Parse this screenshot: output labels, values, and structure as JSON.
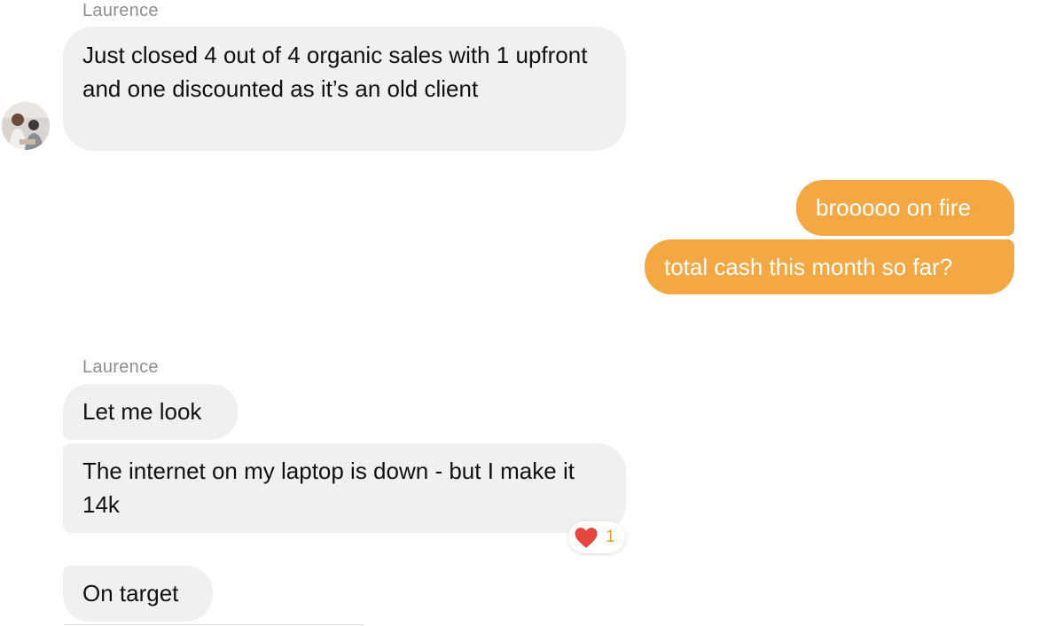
{
  "colors": {
    "incoming_bubble": "#f0f0f0",
    "outgoing_bubble": "#f3a843",
    "reaction_count": "#e99b34",
    "heart": "#e5473f"
  },
  "messages": [
    {
      "sender": "Laurence",
      "text": "Just closed 4 out of 4 organic sales with 1 upfront and one discounted as it’s an old client"
    },
    {
      "direction": "outgoing",
      "text": "brooooo on fire"
    },
    {
      "direction": "outgoing",
      "text": "total cash this month so far?"
    },
    {
      "sender": "Laurence",
      "text": "Let me look"
    },
    {
      "text": "The internet on my laptop is down  - but I make it 14k",
      "reaction": {
        "icon": "heart-icon",
        "count": "1"
      }
    },
    {
      "text": "On target"
    }
  ]
}
